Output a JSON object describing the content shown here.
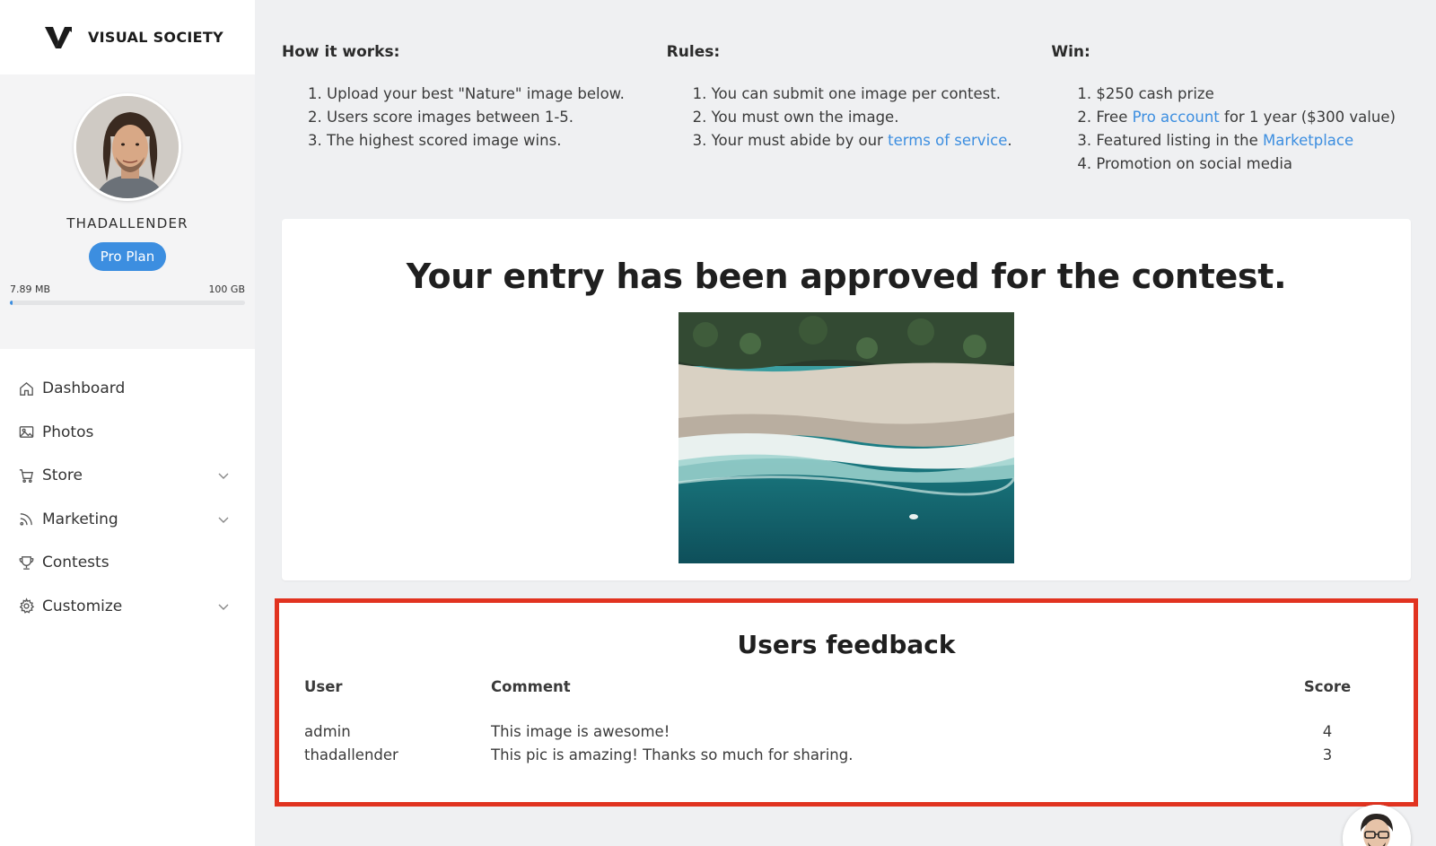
{
  "brand": {
    "name": "VISUAL SOCIETY"
  },
  "profile": {
    "username": "THADALLENDER",
    "plan_label": "Pro Plan",
    "storage_used": "7.89 MB",
    "storage_total": "100 GB",
    "storage_fraction": 0.01
  },
  "sidebar": {
    "items": [
      {
        "label": "Dashboard",
        "icon": "home-icon",
        "has_chevron": false
      },
      {
        "label": "Photos",
        "icon": "image-icon",
        "has_chevron": false
      },
      {
        "label": "Store",
        "icon": "cart-icon",
        "has_chevron": true
      },
      {
        "label": "Marketing",
        "icon": "rss-icon",
        "has_chevron": true
      },
      {
        "label": "Contests",
        "icon": "trophy-icon",
        "has_chevron": false
      },
      {
        "label": "Customize",
        "icon": "gear-icon",
        "has_chevron": true
      }
    ]
  },
  "how_it_works": {
    "title": "How it works:",
    "items": [
      "Upload your best \"Nature\" image below.",
      "Users score images between 1-5.",
      "The highest scored image wins."
    ]
  },
  "rules": {
    "title": "Rules:",
    "item1": "You can submit one image per contest.",
    "item2": "You must own the image.",
    "item3_prefix": "Your must abide by our ",
    "item3_link": "terms of service",
    "item3_suffix": "."
  },
  "win": {
    "title": "Win:",
    "item1": "$250 cash prize",
    "item2_prefix": "Free ",
    "item2_link": "Pro account",
    "item2_suffix": " for 1 year ($300 value)",
    "item3_prefix": "Featured listing in the ",
    "item3_link": "Marketplace",
    "item4": "Promotion on social media"
  },
  "approved": {
    "heading": "Your entry has been approved for the contest."
  },
  "feedback": {
    "title": "Users feedback",
    "columns": {
      "user": "User",
      "comment": "Comment",
      "score": "Score"
    },
    "rows": [
      {
        "user": "admin",
        "comment": "This image is awesome!",
        "score": "4"
      },
      {
        "user": "thadallender",
        "comment": "This pic is amazing! Thanks so much for sharing.",
        "score": "3"
      }
    ]
  },
  "colors": {
    "accent": "#3c8ee0",
    "highlight": "#e13320",
    "background": "#eff0f2"
  }
}
